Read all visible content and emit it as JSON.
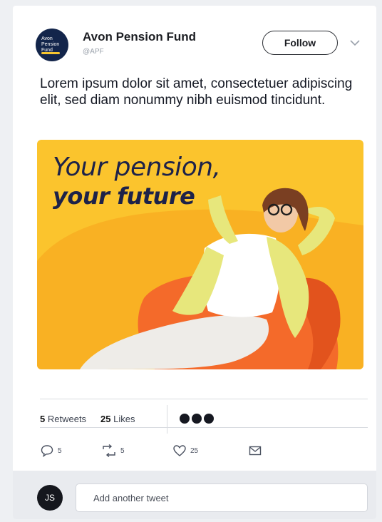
{
  "account": {
    "name": "Avon Pension Fund",
    "handle": "@APF",
    "logo_text": [
      "Avon",
      "Pension",
      "Fund"
    ],
    "follow_label": "Follow"
  },
  "tweet": {
    "text": "Lorem ipsum dolor sit amet, consectetuer adipiscing elit, sed diam nonummy nibh euismod tincidunt."
  },
  "media": {
    "headline_line1": "Your pension,",
    "headline_line2": "your future",
    "background_color": "#fbc42d",
    "accent_color": "#f46a2a"
  },
  "stats": {
    "retweets_count": "5",
    "retweets_label": "Retweets",
    "likes_count": "25",
    "likes_label": "Likes"
  },
  "actions": {
    "reply_count": "5",
    "retweet_count": "5",
    "like_count": "25"
  },
  "reply": {
    "user_initials": "JS",
    "placeholder": "Add another tweet"
  },
  "icons": [
    "chevron-down-icon",
    "reply-icon",
    "retweet-icon",
    "heart-icon",
    "mail-icon"
  ]
}
